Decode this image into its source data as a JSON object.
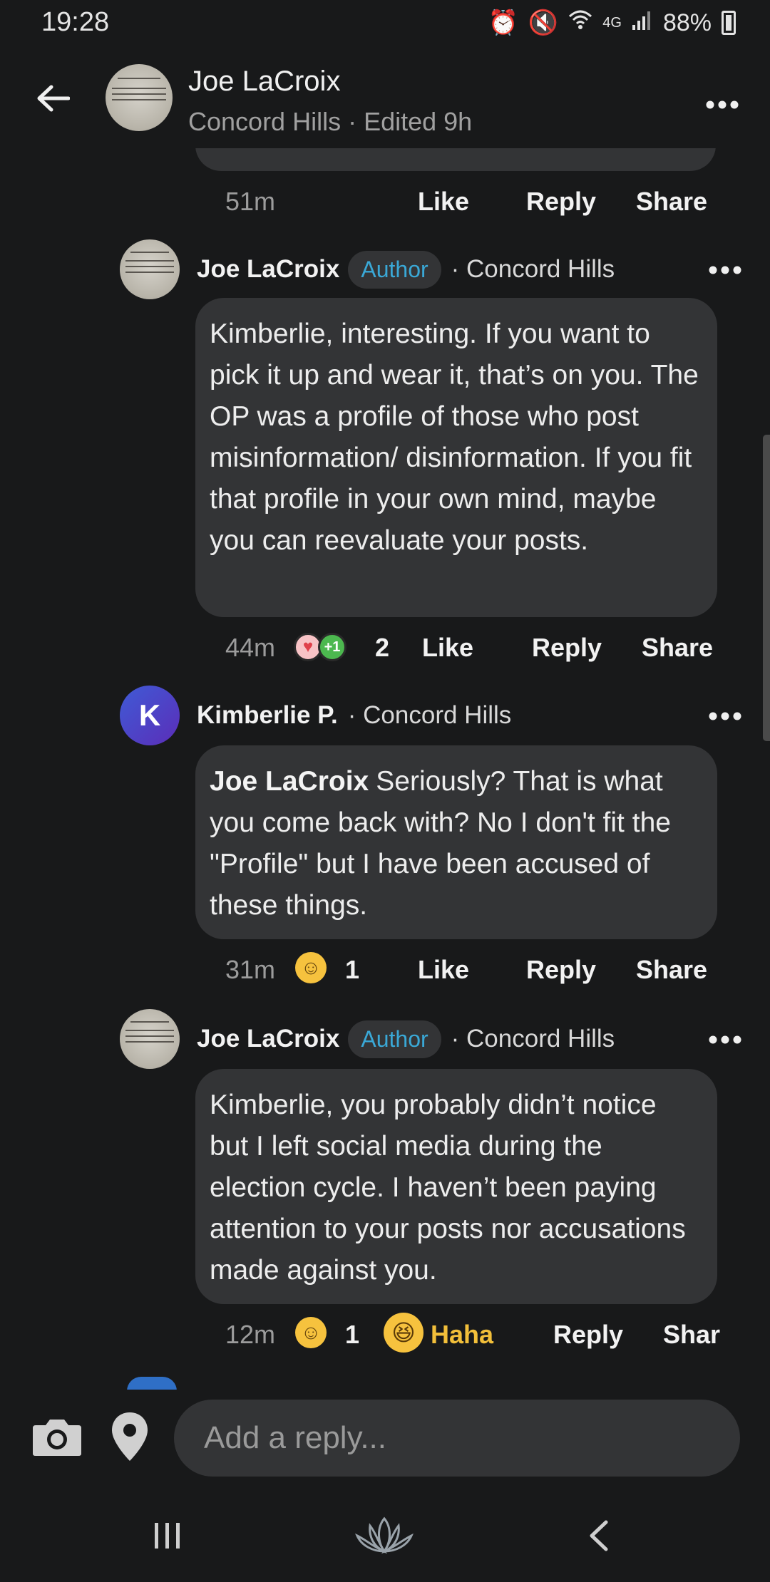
{
  "status_bar": {
    "time": "19:28",
    "network": "4G",
    "battery": "88%"
  },
  "header": {
    "name": "Joe LaCroix",
    "location": "Concord Hills",
    "edited": "· Edited 9h"
  },
  "comments": [
    {
      "time": "51m",
      "like_label": "Like",
      "reply_label": "Reply",
      "share_label": "Share"
    },
    {
      "author": "Joe LaCroix",
      "badge": "Author",
      "location": "· Concord Hills",
      "body": "Kimberlie, interesting. If you want to pick it up and wear it, that’s on you. The OP was a profile of those who post misinformation/ disinformation. If you fit that profile in your own mind, maybe you can reevaluate your posts.",
      "time": "44m",
      "reaction_count": "2",
      "like_label": "Like",
      "reply_label": "Reply",
      "share_label": "Share"
    },
    {
      "author": "Kimberlie P.",
      "avatar_letter": "K",
      "location": "· Concord Hills",
      "mention": "Joe LaCroix",
      "body": "Seriously? That is what you come back with? No I don't fit the \"Profile\" but I have been accused of these things.",
      "time": "31m",
      "reaction_count": "1",
      "like_label": "Like",
      "reply_label": "Reply",
      "share_label": "Share"
    },
    {
      "author": "Joe LaCroix",
      "badge": "Author",
      "location": "· Concord Hills",
      "body": "Kimberlie, you probably didn’t notice but I left social media during the election cycle. I haven’t been paying attention to your posts nor accusations made against you.",
      "time": "12m",
      "reaction_count": "1",
      "haha_label": "Haha",
      "reply_label": "Reply",
      "share_label": "Shar"
    }
  ],
  "reply_bar": {
    "placeholder": "Add a reply..."
  },
  "colors": {
    "background": "#18191a",
    "bubble": "#333436",
    "author_badge_text": "#3aa8d6",
    "haha": "#f2bf3a"
  },
  "icons": {
    "back": "arrow-left-icon",
    "more": "more-dots-icon",
    "camera": "camera-icon",
    "location": "location-pin-icon",
    "nav_recents": "recent-apps-icon",
    "nav_home": "lotus-home-icon",
    "nav_back": "chevron-left-icon"
  }
}
